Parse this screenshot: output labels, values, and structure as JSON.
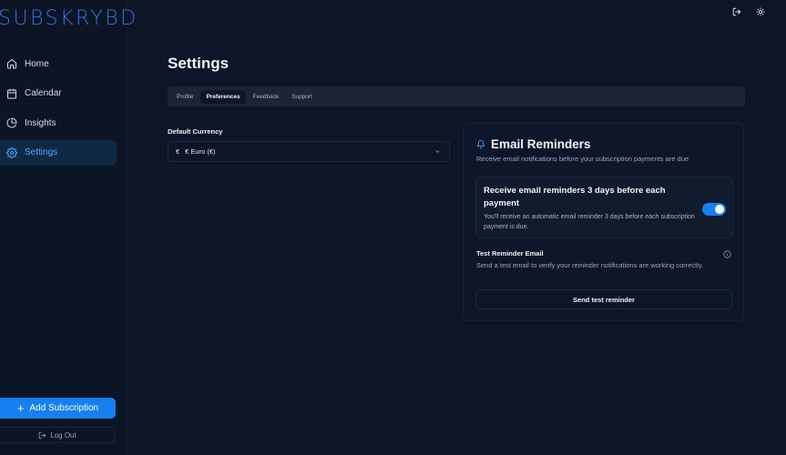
{
  "app": {
    "logo": "SUBSKRYBD"
  },
  "sidebar": {
    "items": [
      {
        "label": "Home",
        "icon": "home-icon",
        "active": false
      },
      {
        "label": "Calendar",
        "icon": "calendar-icon",
        "active": false
      },
      {
        "label": "Insights",
        "icon": "pie-chart-icon",
        "active": false
      },
      {
        "label": "Settings",
        "icon": "gear-icon",
        "active": true
      }
    ],
    "add_label": "Add Subscription",
    "logout_label": "Log Out"
  },
  "header": {
    "icons": [
      "logout-icon",
      "sun-icon"
    ]
  },
  "settings": {
    "title": "Settings",
    "tabs": [
      {
        "label": "Profile",
        "active": false
      },
      {
        "label": "Preferences",
        "active": true
      },
      {
        "label": "Feedback",
        "active": false
      },
      {
        "label": "Support",
        "active": false
      }
    ],
    "currency": {
      "label": "Default Currency",
      "symbol": "€",
      "value": "€  Euro (€)"
    }
  },
  "reminders": {
    "title": "Email Reminders",
    "subtitle": "Receive email notifications before your subscription payments are due",
    "option_title": "Receive email reminders 3 days before each payment",
    "option_desc": "You'll receive an automatic email reminder 3 days before each subscription payment is due.",
    "enabled": true,
    "test_title": "Test Reminder Email",
    "test_desc": "Send a test email to verify your reminder notifications are working correctly.",
    "send_label": "Send test reminder"
  },
  "colors": {
    "accent": "#1780f0",
    "background": "#0d1628",
    "active_nav_bg": "#112844"
  }
}
